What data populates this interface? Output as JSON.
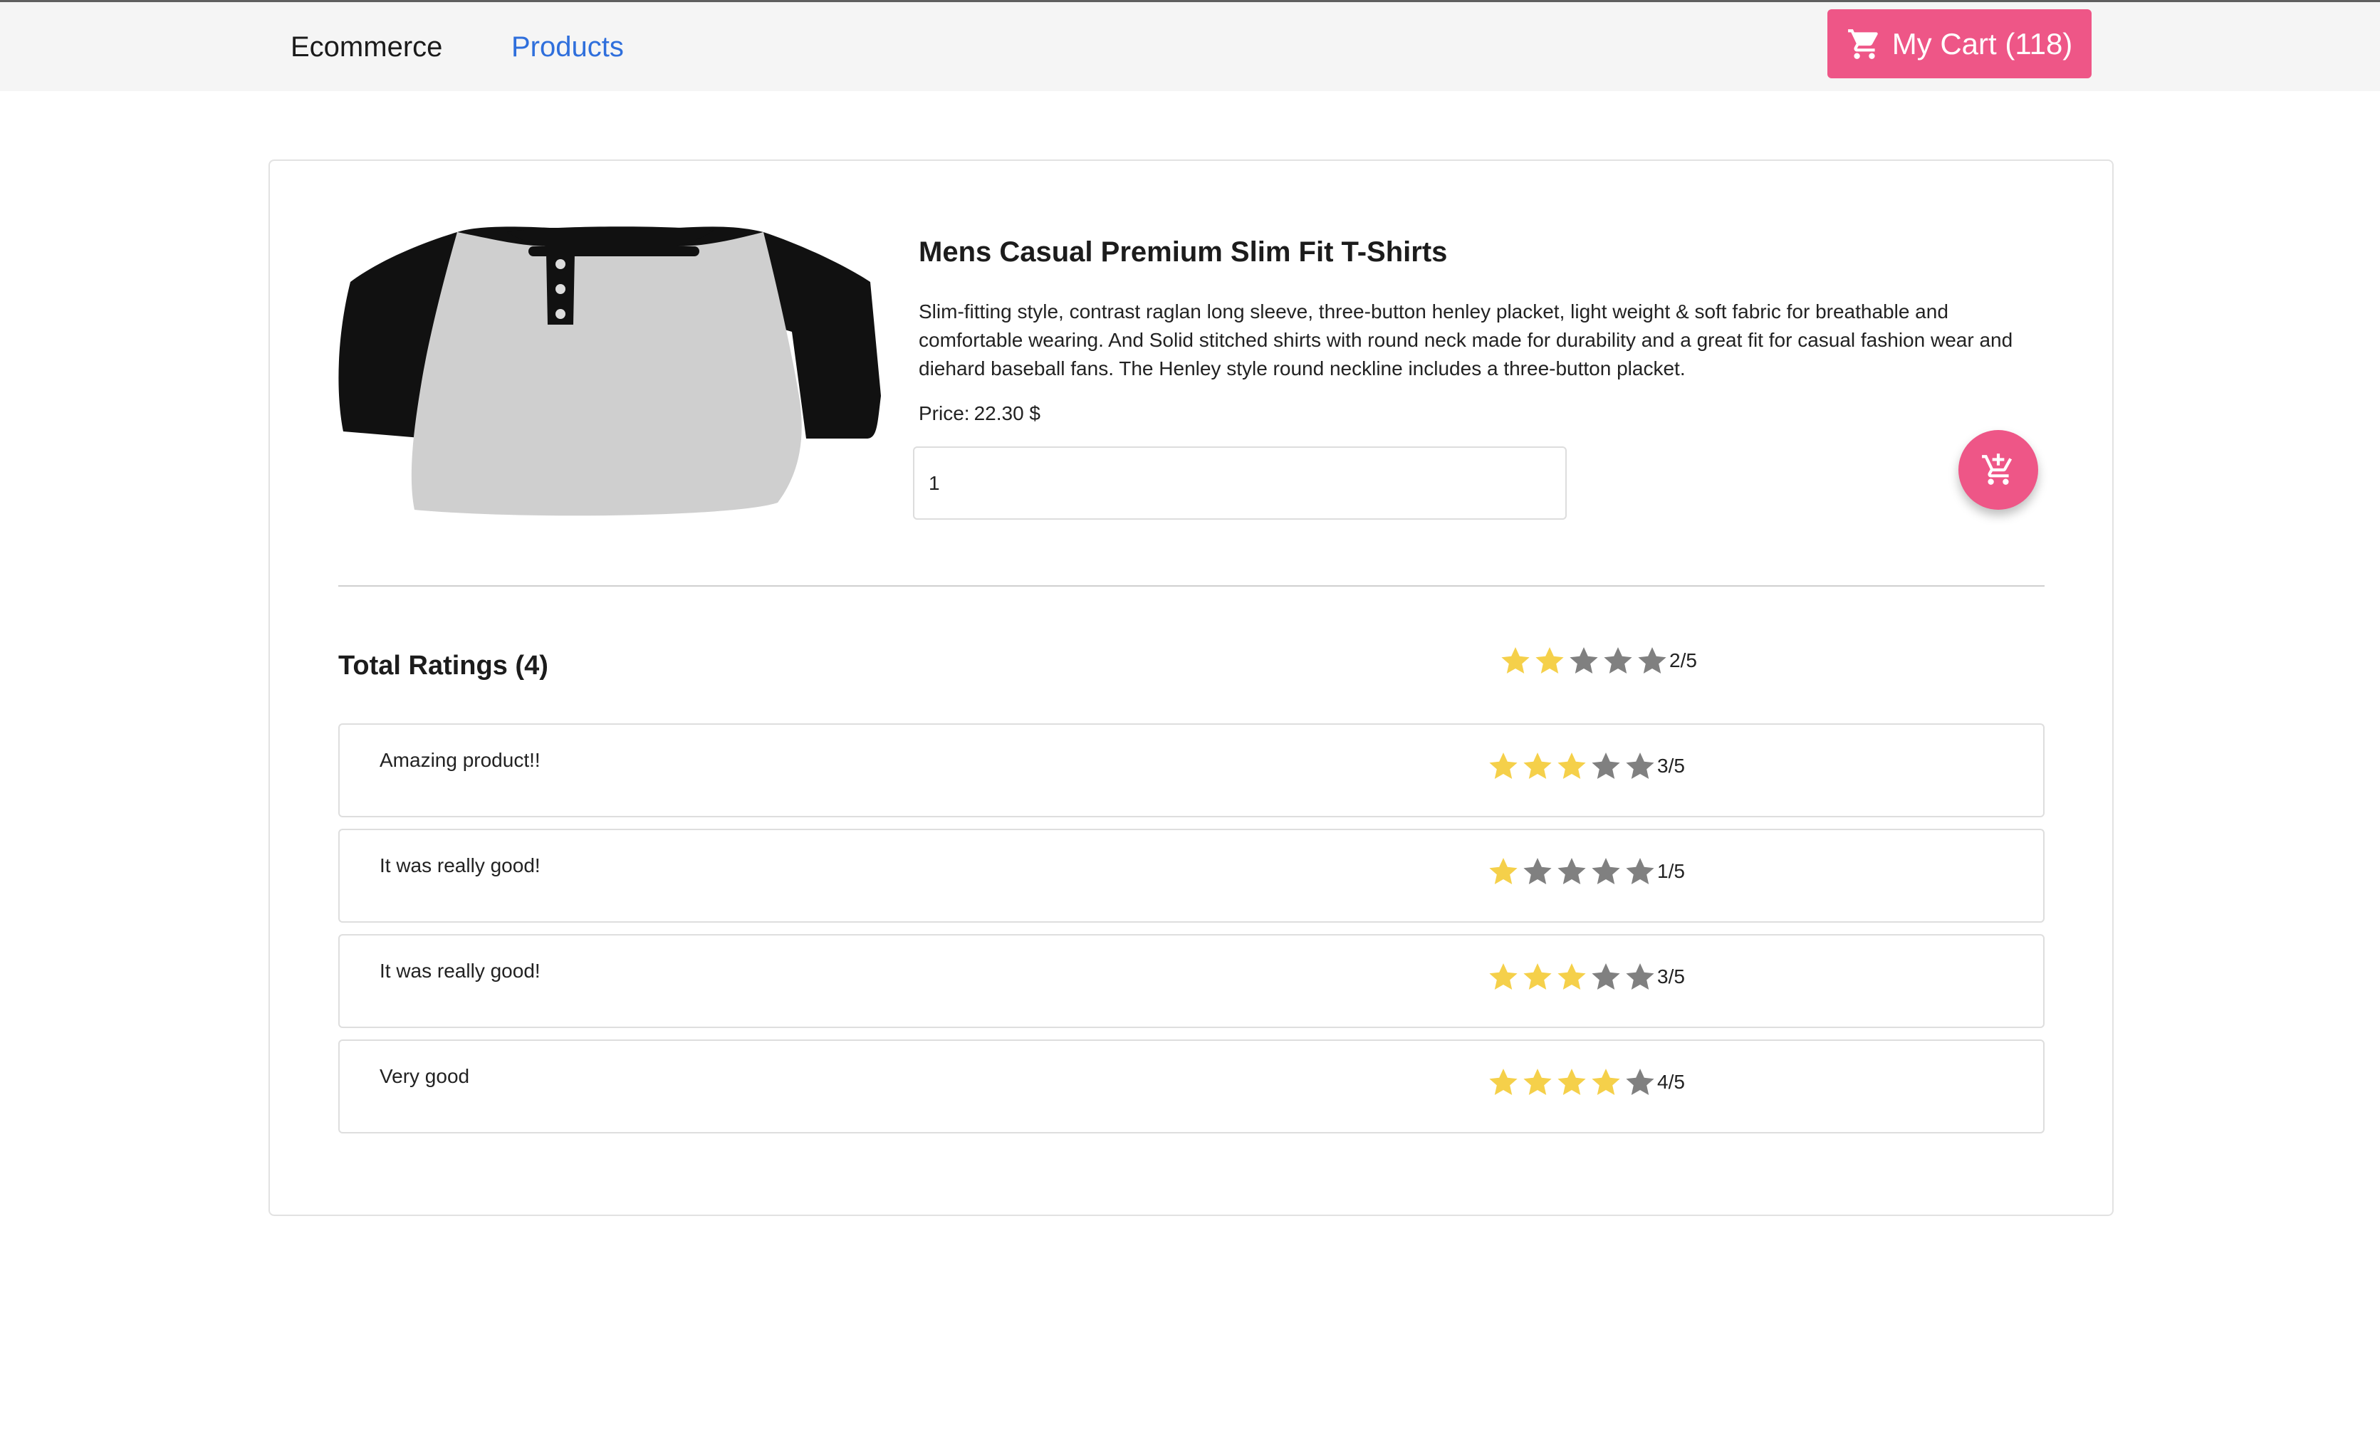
{
  "nav": {
    "brand": "Ecommerce",
    "products_link": "Products",
    "cart_label": "My Cart (118)",
    "cart_icon": "shopping-cart-icon"
  },
  "product": {
    "image_icon": "tshirt-image",
    "title": "Mens Casual Premium Slim Fit T-Shirts",
    "description": "Slim-fitting style, contrast raglan long sleeve, three-button henley placket, light weight & soft fabric for breathable and comfortable wearing. And Solid stitched shirts with round neck made for durability and a great fit for casual fashion wear and diehard baseball fans. The Henley style round neckline includes a three-button placket.",
    "price_label": "Price:",
    "price_value": "22.30 $",
    "quantity": "1",
    "add_to_cart_icon": "add-shopping-cart-icon"
  },
  "ratings": {
    "title": "Total Ratings (4)",
    "average": 2,
    "average_label": "2/5",
    "max": 5,
    "reviews": [
      {
        "text": "Amazing product!!",
        "rating": 3,
        "rating_label": "3/5"
      },
      {
        "text": "It was really good!",
        "rating": 1,
        "rating_label": "1/5"
      },
      {
        "text": "It was really good!",
        "rating": 3,
        "rating_label": "3/5"
      },
      {
        "text": "Very good",
        "rating": 4,
        "rating_label": "4/5"
      }
    ]
  },
  "colors": {
    "accent": "#ee5687",
    "link": "#2f6fdc",
    "star_filled": "#f5d04a",
    "star_empty": "#808080",
    "navbar_bg": "#f5f5f5"
  }
}
